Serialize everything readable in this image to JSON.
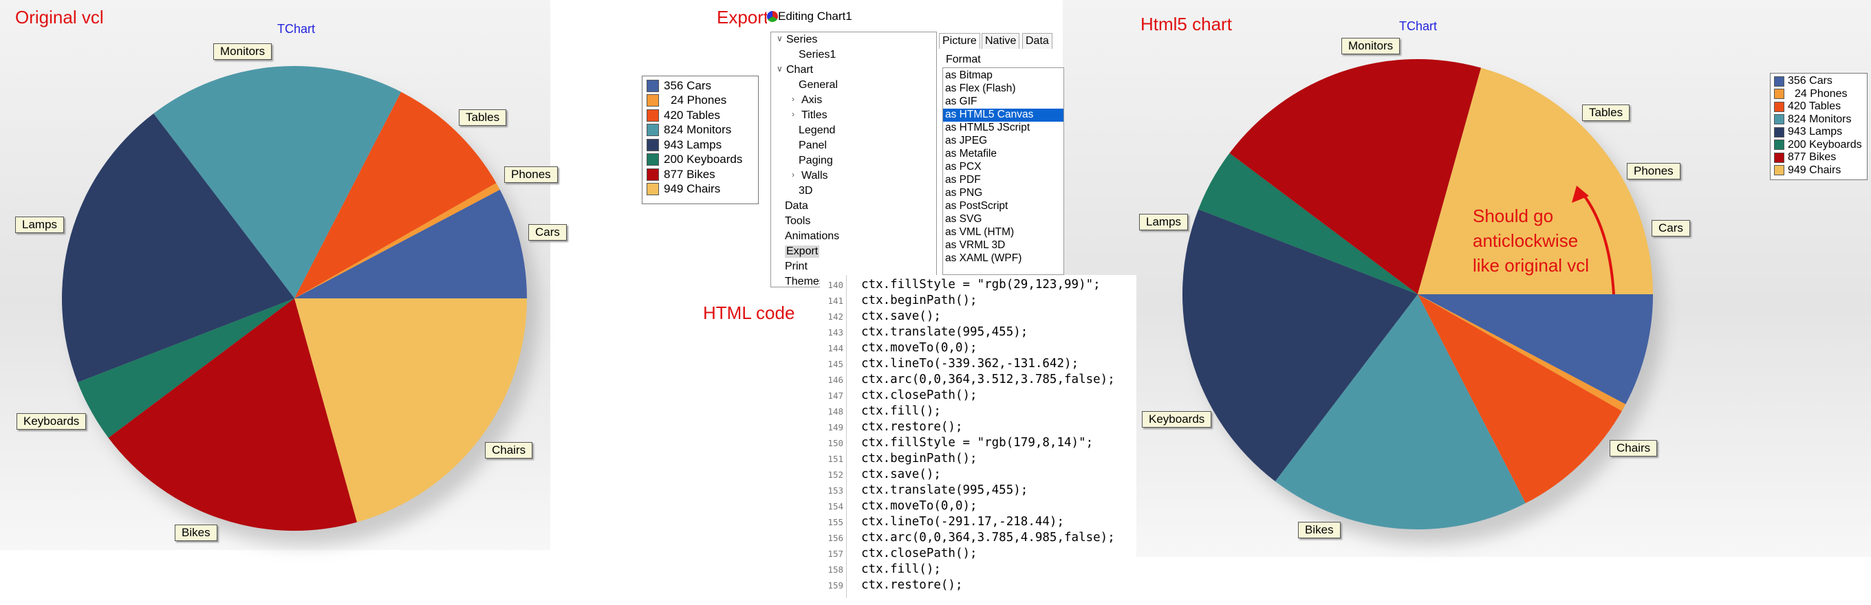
{
  "captions": {
    "original": "Original vcl",
    "export": "Export",
    "html_code": "HTML code",
    "html5": "Html5 chart",
    "note_lines": [
      "Should go",
      "anticlockwise",
      "like original vcl"
    ]
  },
  "chart_data": [
    {
      "type": "pie",
      "title": "TChart",
      "categories": [
        "Cars",
        "Phones",
        "Tables",
        "Monitors",
        "Lamps",
        "Keyboards",
        "Bikes",
        "Chairs"
      ],
      "values": [
        356,
        24,
        420,
        824,
        943,
        200,
        877,
        949
      ],
      "colors": [
        "#4461a2",
        "#f59a36",
        "#ee5019",
        "#4d98a7",
        "#2c3e66",
        "#1e7a62",
        "#b3080e",
        "#f2bf5c"
      ],
      "direction": "anticlockwise",
      "start_angle_deg": 0,
      "legend_items": [
        "356 Cars",
        "24 Phones",
        "420 Tables",
        "824 Monitors",
        "943 Lamps",
        "200 Keyboards",
        "877 Bikes",
        "949 Chairs"
      ],
      "legend_position": "right"
    },
    {
      "type": "pie",
      "title": "TChart",
      "categories": [
        "Cars",
        "Phones",
        "Tables",
        "Monitors",
        "Lamps",
        "Keyboards",
        "Bikes",
        "Chairs"
      ],
      "values": [
        356,
        24,
        420,
        824,
        943,
        200,
        877,
        949
      ],
      "colors": [
        "#4461a2",
        "#f59a36",
        "#ee5019",
        "#4d98a7",
        "#2c3e66",
        "#1e7a62",
        "#b3080e",
        "#f2bf5c"
      ],
      "direction": "clockwise",
      "start_angle_deg": 0,
      "legend_items": [
        "356 Cars",
        "24 Phones",
        "420 Tables",
        "824 Monitors",
        "943 Lamps",
        "200 Keyboards",
        "877 Bikes",
        "949 Chairs"
      ],
      "legend_position": "right"
    }
  ],
  "mark_labels_left": [
    "Monitors",
    "Tables",
    "Phones",
    "Cars",
    "Lamps",
    "Keyboards",
    "Chairs",
    "Bikes"
  ],
  "mark_labels_right": [
    "Monitors",
    "Tables",
    "Phones",
    "Cars",
    "Lamps",
    "Keyboards",
    "Chairs",
    "Bikes"
  ],
  "editor": {
    "title": "Editing Chart1",
    "tree": [
      "Series",
      "Series1",
      "Chart",
      "General",
      "Axis",
      "Titles",
      "Legend",
      "Panel",
      "Paging",
      "Walls",
      "3D",
      "Data",
      "Tools",
      "Animations",
      "Export",
      "Print",
      "Themes"
    ],
    "tabs": [
      "Picture",
      "Native",
      "Data"
    ],
    "format_label": "Format",
    "formats": [
      "as Bitmap",
      "as Flex (Flash)",
      "as GIF",
      "as HTML5 Canvas",
      "as HTML5 JScript",
      "as JPEG",
      "as Metafile",
      "as PCX",
      "as PDF",
      "as PNG",
      "as PostScript",
      "as SVG",
      "as VML (HTM)",
      "as VRML 3D",
      "as XAML (WPF)"
    ],
    "selected_format": "as HTML5 Canvas"
  },
  "code": {
    "line_numbers": [
      "140",
      "141",
      "142",
      "143",
      "144",
      "145",
      "146",
      "147",
      "148",
      "149",
      "150",
      "151",
      "152",
      "153",
      "154",
      "155",
      "156",
      "157",
      "158",
      "159"
    ],
    "lines": [
      "ctx.fillStyle = \"rgb(29,123,99)\";",
      "ctx.beginPath();",
      "ctx.save();",
      "ctx.translate(995,455);",
      "ctx.moveTo(0,0);",
      "ctx.lineTo(-339.362,-131.642);",
      "ctx.arc(0,0,364,3.512,3.785,false);",
      "ctx.closePath();",
      "ctx.fill();",
      "ctx.restore();",
      "ctx.fillStyle = \"rgb(179,8,14)\";",
      "ctx.beginPath();",
      "ctx.save();",
      "ctx.translate(995,455);",
      "ctx.moveTo(0,0);",
      "ctx.lineTo(-291.17,-218.44);",
      "ctx.arc(0,0,364,3.785,4.985,false);",
      "ctx.closePath();",
      "ctx.fill();",
      "ctx.restore();"
    ]
  },
  "arrow_color": "#e01010"
}
